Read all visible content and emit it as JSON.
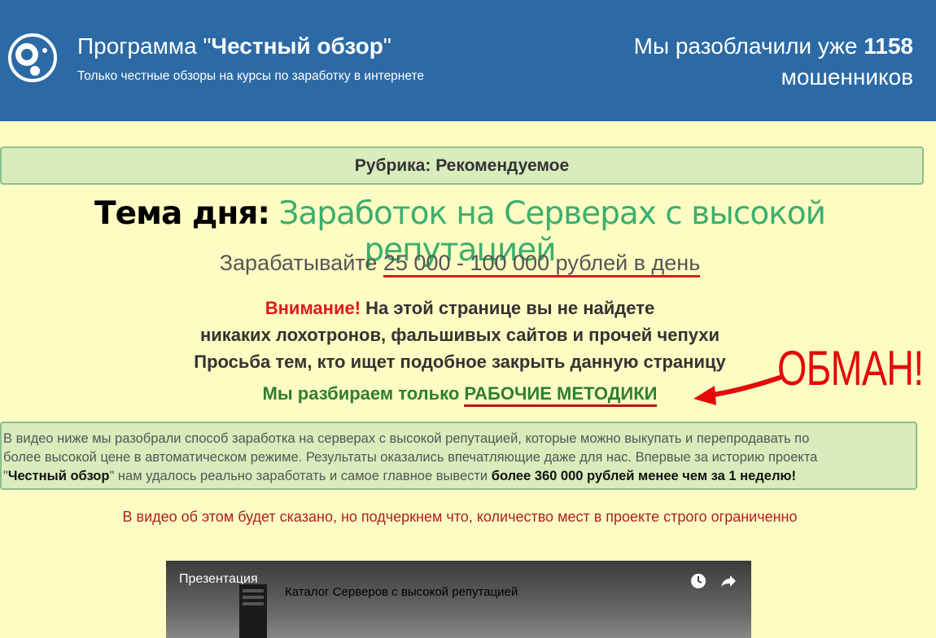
{
  "header": {
    "title_prefix": "Программа \"",
    "title_bold": "Честный обзор",
    "title_suffix": "\"",
    "subtitle": "Только честные обзоры на курсы по заработку в интернете",
    "counter_prefix": "Мы разоблачили уже",
    "counter_value": "1158",
    "counter_suffix": "мошенников"
  },
  "rubric": "Рубрика: Рекомендуемое",
  "topic": {
    "label": "Тема дня:",
    "value": "Заработок на Серверах с высокой репутацией"
  },
  "earn": {
    "prefix": "Зарабатывайте",
    "amount": "25 000 - 100 000 рублей в день"
  },
  "warning": {
    "attention": "Внимание!",
    "line1": "На этой странице вы не найдете",
    "line2": "никаких лохотронов, фальшивых сайтов и прочей чепухи",
    "line3": "Просьба тем, кто ищет подобное закрыть данную страницу"
  },
  "methods": {
    "prefix": "Мы разбираем только",
    "highlight": "РАБОЧИЕ МЕТОДИКИ"
  },
  "annotation": {
    "text": "ОБМАН!",
    "color": "#e40a0a"
  },
  "info": {
    "line1": "В видео ниже мы разобрали способ заработка на серверах с высокой репутацией, которые можно выкупать и перепродавать по",
    "line2": "более высокой цене в автоматическом режиме. Результаты оказались впечатляющие даже для нас. Впервые за историю проекта",
    "line3_pre": "\"",
    "line3_bold": "Честный обзор",
    "line3_mid": "\" нам удалось реально заработать и самое главное вывести ",
    "line3_bold2": "более 360 000 рублей менее чем за 1 неделю!"
  },
  "limited": "В видео об этом будет сказано, но подчеркнем что, количество мест в проекте строго ограниченно",
  "video": {
    "channel": "Презентация",
    "title": "Каталог Серверов с высокой репутацией",
    "icons": [
      "clock-icon",
      "share-icon"
    ]
  },
  "colors": {
    "header_bg": "#2c6aa5",
    "page_bg": "#fdfdc3",
    "accent_green": "#3dae6e",
    "warning_red": "#dd1a1a"
  }
}
